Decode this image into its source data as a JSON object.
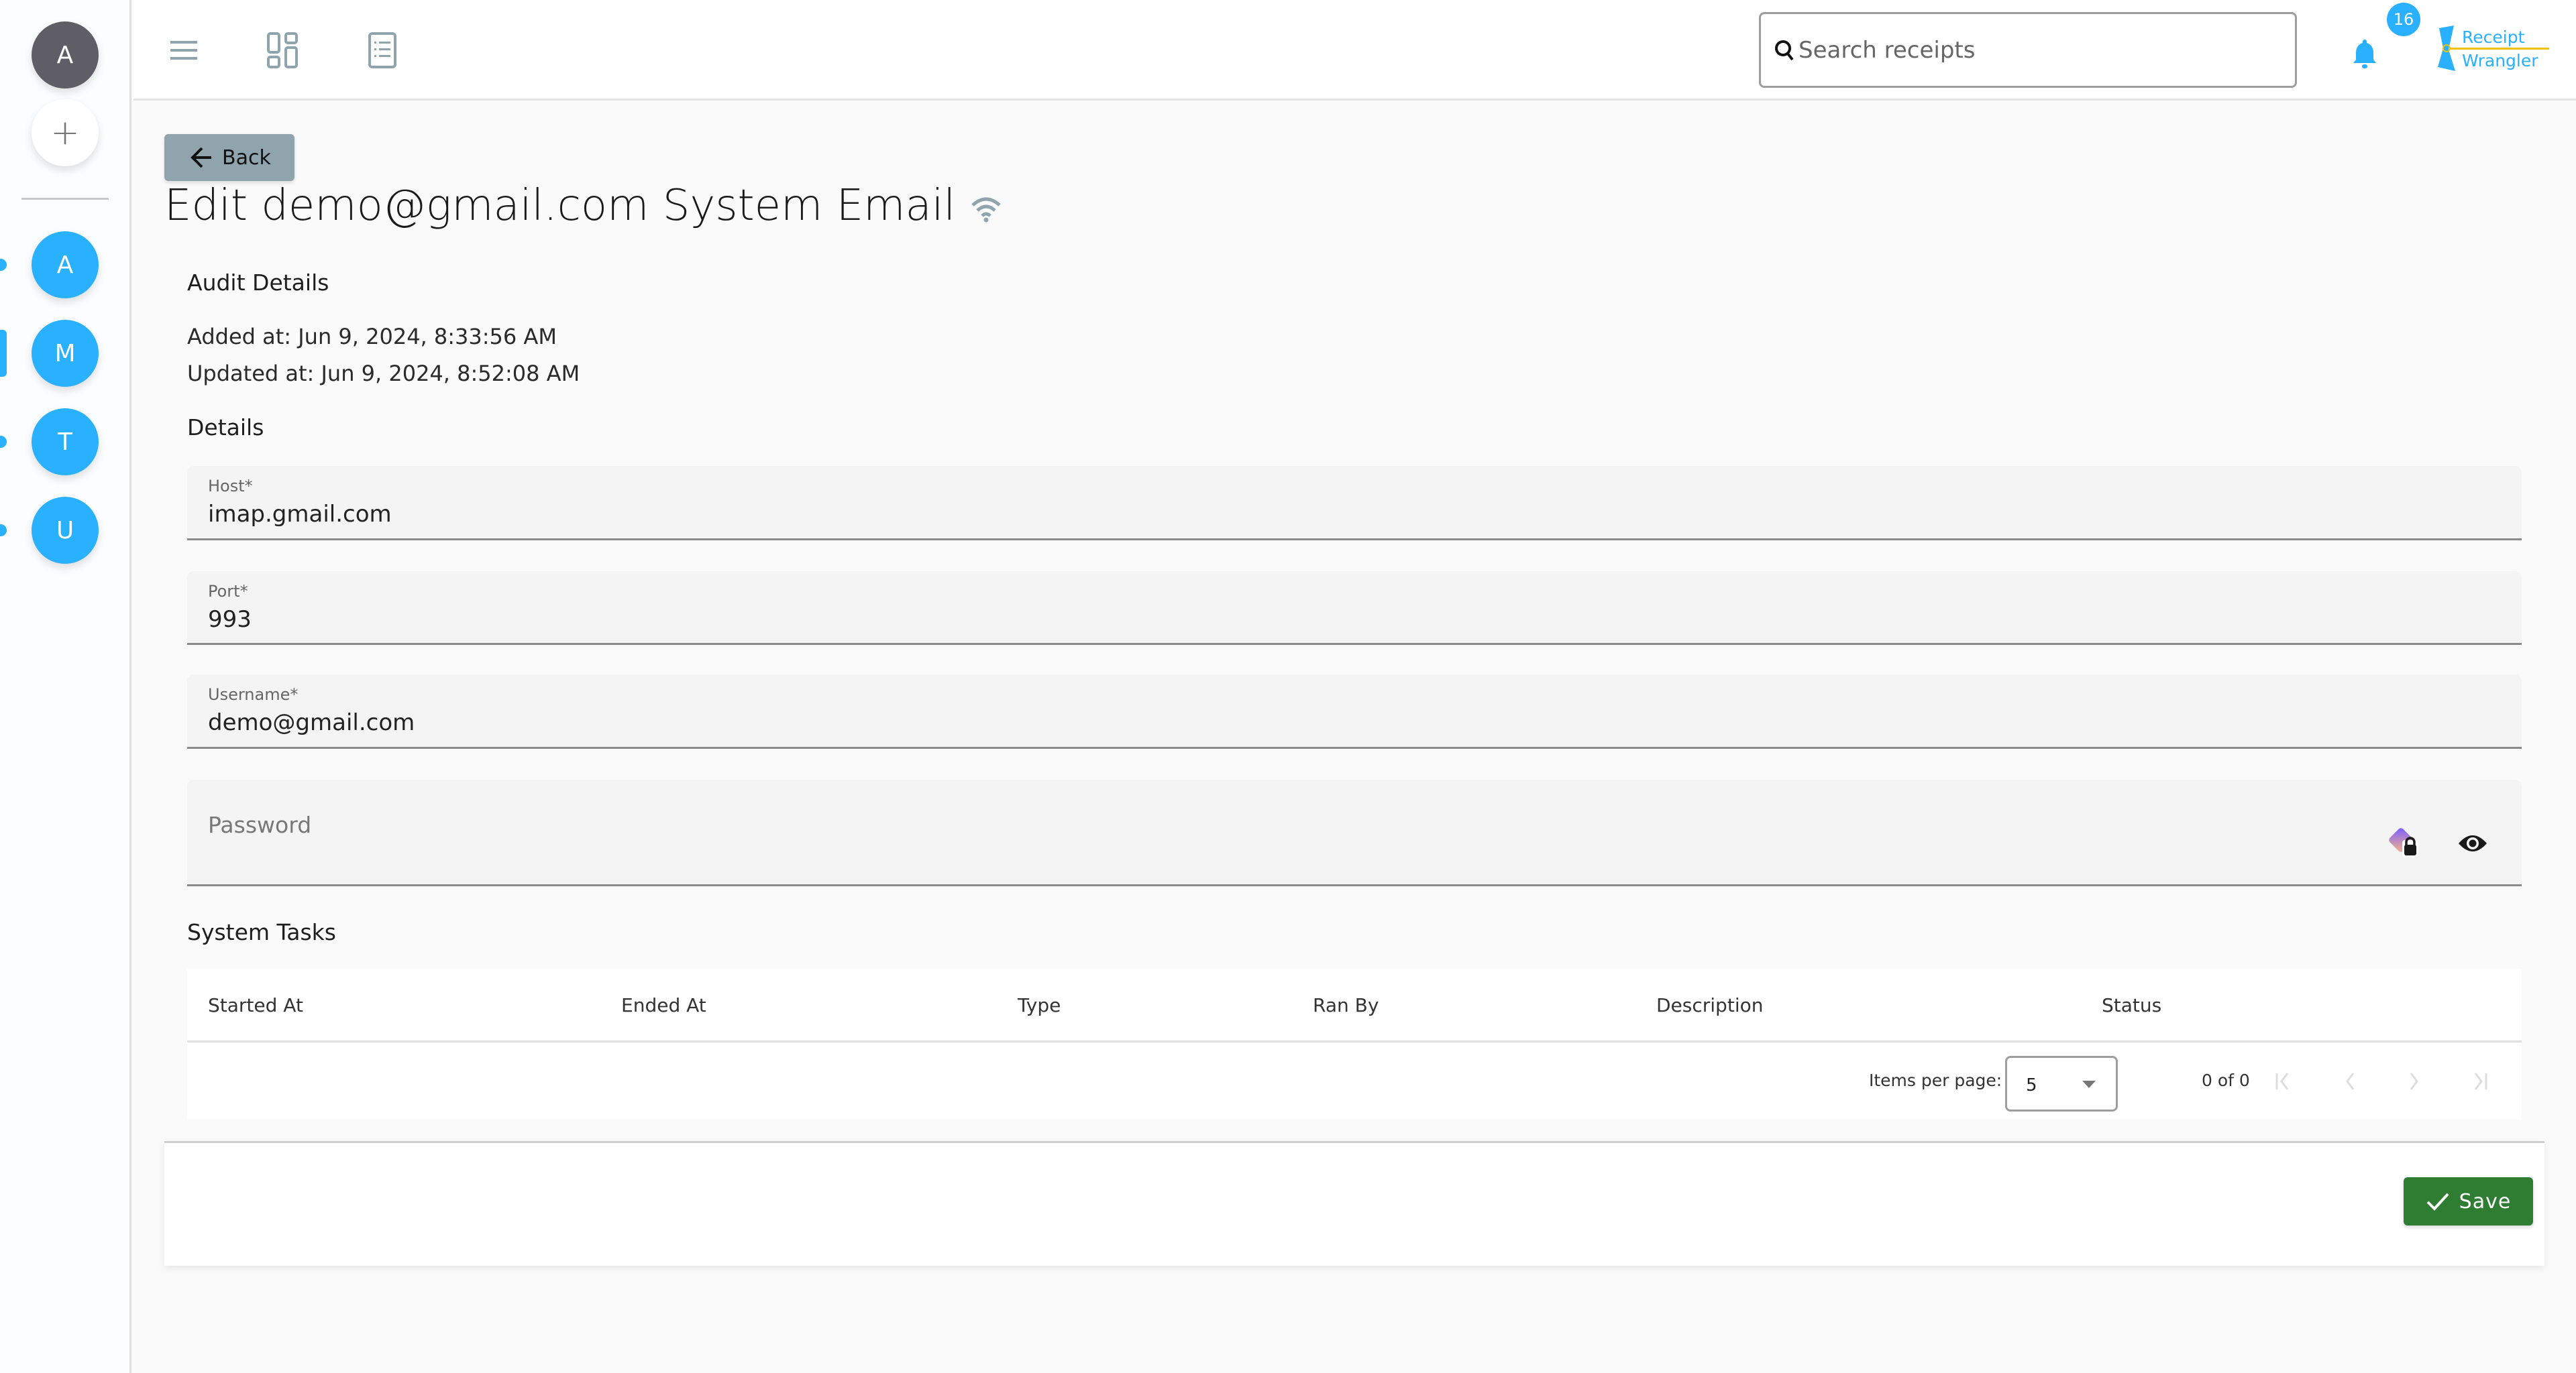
{
  "sidebar": {
    "user_avatar": "A",
    "add_label": "+",
    "groups": [
      {
        "initial": "A",
        "active": false
      },
      {
        "initial": "M",
        "active": true
      },
      {
        "initial": "T",
        "active": false
      },
      {
        "initial": "U",
        "active": false
      }
    ]
  },
  "header": {
    "icons": [
      "menu-icon",
      "dashboard-icon",
      "receipt-list-icon"
    ],
    "search": {
      "placeholder": "Search receipts",
      "value": ""
    },
    "notification_count": "16",
    "logo": {
      "line1": "Receipt",
      "line2": "Wrangler"
    }
  },
  "page": {
    "back_label": "Back",
    "title": "Edit demo@gmail.com System Email",
    "title_icon": "connection-status-icon"
  },
  "audit": {
    "heading": "Audit Details",
    "added_at": "Added at: Jun 9, 2024, 8:33:56 AM",
    "updated_at": "Updated at: Jun 9, 2024, 8:52:08 AM"
  },
  "details": {
    "heading": "Details",
    "host": {
      "label": "Host*",
      "value": "imap.gmail.com"
    },
    "port": {
      "label": "Port*",
      "value": "993"
    },
    "username": {
      "label": "Username*",
      "value": "demo@gmail.com"
    },
    "password": {
      "label": "Password",
      "value": ""
    }
  },
  "system_tasks": {
    "heading": "System Tasks",
    "columns": [
      "Started At",
      "Ended At",
      "Type",
      "Ran By",
      "Description",
      "Status"
    ],
    "rows": [],
    "paginator": {
      "items_per_page_label": "Items per page:",
      "items_per_page": "5",
      "range_label": "0 of 0"
    }
  },
  "footer": {
    "save_label": "Save"
  },
  "colors": {
    "accent": "#29b0fe",
    "save": "#2e7d32",
    "back": "#90a4ae"
  }
}
